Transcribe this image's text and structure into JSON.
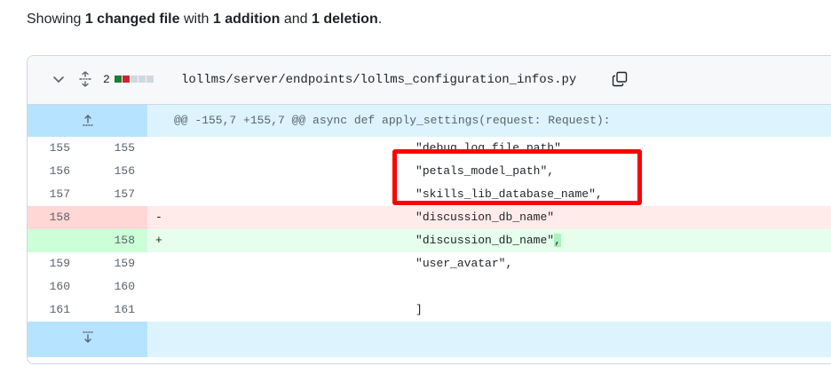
{
  "summary": {
    "prefix": "Showing ",
    "files": "1 changed file",
    "mid1": " with ",
    "additions": "1 addition",
    "mid2": " and ",
    "deletions": "1 deletion",
    "suffix": "."
  },
  "file": {
    "change_count": "2",
    "path": "lollms/server/endpoints/lollms_configuration_infos.py",
    "colors": {
      "add": "#1a7f37",
      "del": "#cf222e",
      "neutral": "#d0d7de"
    }
  },
  "hunk": {
    "header": "@@ -155,7 +155,7 @@ async def apply_settings(request: Request):"
  },
  "lines": [
    {
      "type": "ctx",
      "old": "155",
      "new": "155",
      "marker": "",
      "code": "                                   \"debug_log_file_path\","
    },
    {
      "type": "ctx",
      "old": "156",
      "new": "156",
      "marker": "",
      "code": "                                   \"petals_model_path\","
    },
    {
      "type": "ctx",
      "old": "157",
      "new": "157",
      "marker": "",
      "code": "                                   \"skills_lib_database_name\","
    },
    {
      "type": "del",
      "old": "158",
      "new": "",
      "marker": "-",
      "code": "                                   \"discussion_db_name\""
    },
    {
      "type": "add",
      "old": "",
      "new": "158",
      "marker": "+",
      "code": "                                   \"discussion_db_name\"",
      "added": ","
    },
    {
      "type": "ctx",
      "old": "159",
      "new": "159",
      "marker": "",
      "code": "                                   \"user_avatar\","
    },
    {
      "type": "ctx",
      "old": "160",
      "new": "160",
      "marker": "",
      "code": ""
    },
    {
      "type": "ctx",
      "old": "161",
      "new": "161",
      "marker": "",
      "code": "                                   ]"
    }
  ]
}
